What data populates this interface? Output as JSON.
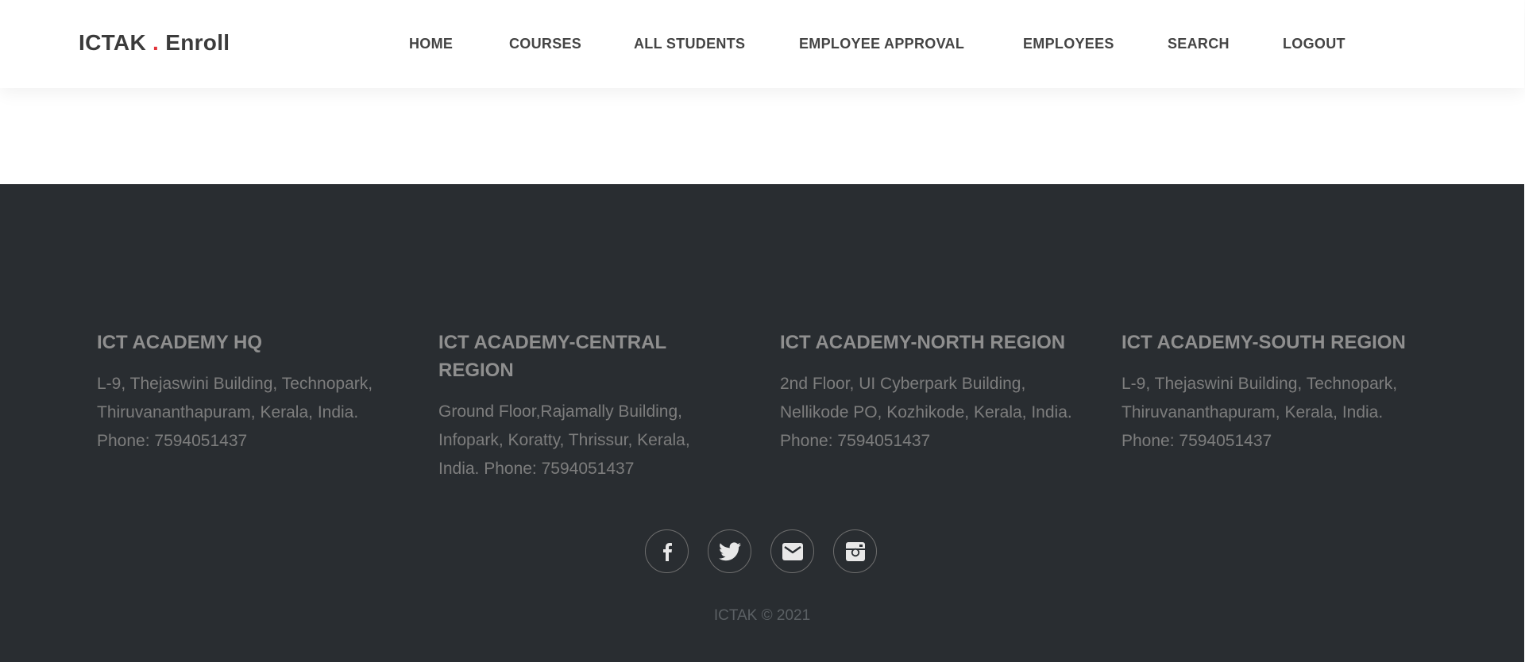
{
  "brand": {
    "name_part1": "ICTAK ",
    "dot": ".",
    "name_part2": " Enroll",
    "dot_color": "#e2343b"
  },
  "nav": {
    "items": [
      {
        "label": "HOME"
      },
      {
        "label": "COURSES"
      },
      {
        "label": "ALL STUDENTS"
      },
      {
        "label": "EMPLOYEE APPROVAL"
      },
      {
        "label": "EMPLOYEES"
      },
      {
        "label": "SEARCH"
      },
      {
        "label": "LOGOUT"
      }
    ]
  },
  "footer": {
    "background": "#292d31",
    "columns": [
      {
        "title": "ICT ACADEMY HQ",
        "address": "L-9, Thejaswini Building, Technopark, Thiruvananthapuram, Kerala, India.",
        "phone": "Phone: 7594051437"
      },
      {
        "title": "ICT ACADEMY-CENTRAL REGION",
        "address": "Ground Floor,Rajamally Building, Infopark, Koratty, Thrissur, Kerala, India. Phone: 7594051437"
      },
      {
        "title": "ICT ACADEMY-NORTH REGION",
        "address": "2nd Floor, UI Cyberpark Building, Nellikode PO, Kozhikode, Kerala, India.",
        "phone": "Phone: 7594051437"
      },
      {
        "title": "ICT ACADEMY-SOUTH REGION",
        "address": "L-9, Thejaswini Building, Technopark, Thiruvananthapuram, Kerala, India.",
        "phone": "Phone: 7594051437"
      }
    ],
    "social_icons": [
      "facebook-icon",
      "twitter-icon",
      "email-icon",
      "instagram-icon"
    ],
    "copyright": "ICTAK © 2021"
  }
}
